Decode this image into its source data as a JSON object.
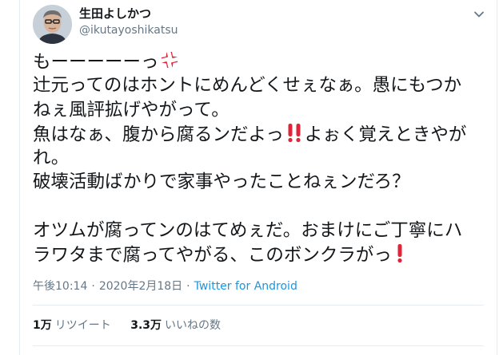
{
  "tweet": {
    "author": {
      "display_name": "生田よしかつ",
      "handle": "@ikutayoshikatsu"
    },
    "body": {
      "line1": "もーーーーーっ",
      "line2": "辻元ってのはホントにめんどくせぇなぁ。愚にもつか",
      "line3": "ねぇ風評拡げやがって。",
      "line4": "魚はなぁ、腹から腐るンだよっ",
      "line4b": "よぉく覚えときやが",
      "line5": "れ。",
      "line6": "破壊活動ばかりで家事やったことねぇンだろ？",
      "line8": "オツムが腐ってンのはてめぇだ。おまけにご丁寧にハ",
      "line9": "ラワタまで腐ってやがる、このボンクラがっ"
    },
    "emoji": {
      "anger": "anger-symbol-icon",
      "double_exclamation": "double-exclamation-icon",
      "exclamation": "exclamation-icon"
    },
    "meta": {
      "time": "午後10:14",
      "separator": "·",
      "date": "2020年2月18日",
      "source": "Twitter for Android"
    },
    "stats": {
      "retweets_count": "1万",
      "retweets_label": "リツイート",
      "likes_count": "3.3万",
      "likes_label": "いいねの数"
    },
    "colors": {
      "link": "#1b95e0",
      "secondary_text": "#657786",
      "emoji_red": "#e0243a",
      "divider": "#e6ecf0"
    }
  }
}
